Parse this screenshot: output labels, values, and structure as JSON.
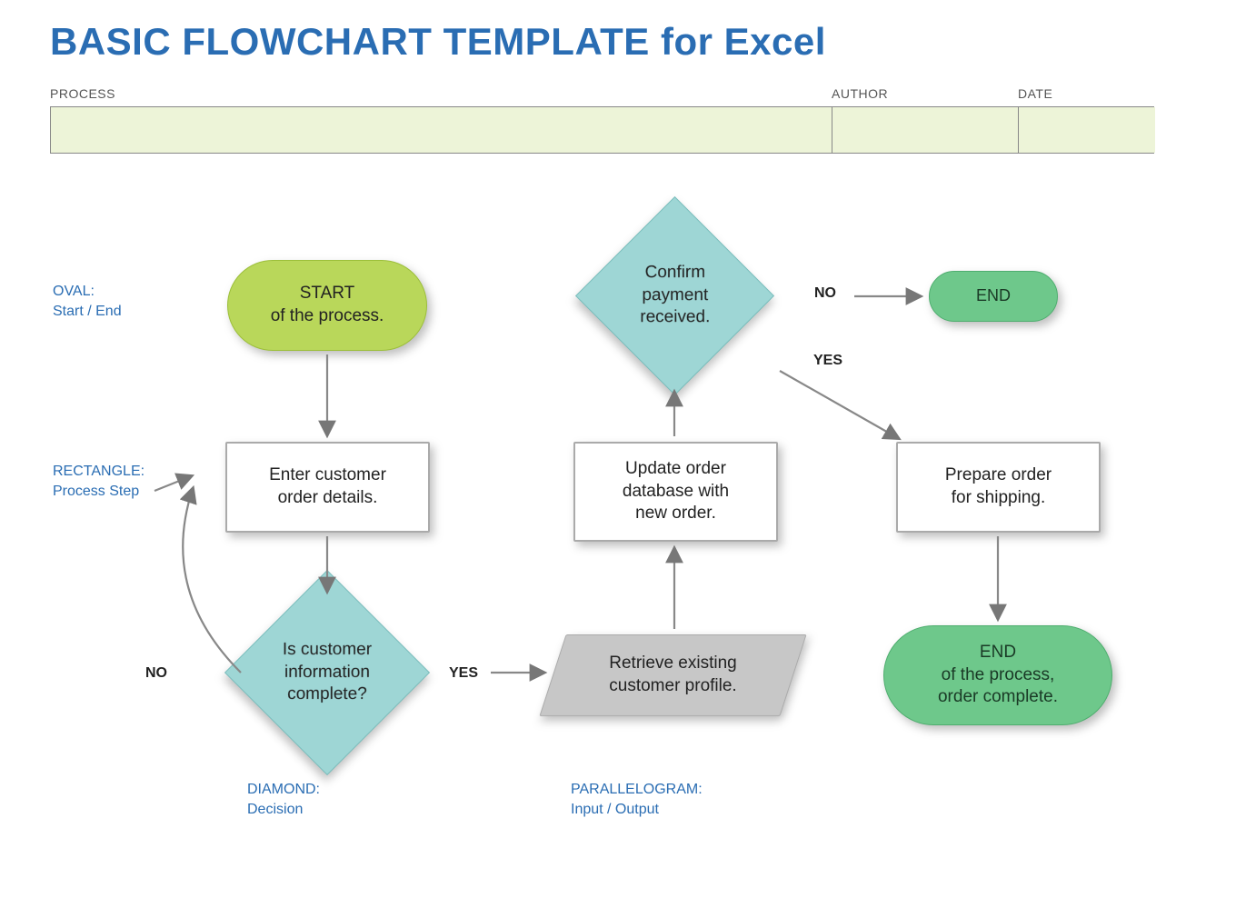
{
  "title": "BASIC FLOWCHART TEMPLATE for Excel",
  "header": {
    "process_label": "PROCESS",
    "author_label": "AUTHOR",
    "date_label": "DATE",
    "process_value": "",
    "author_value": "",
    "date_value": ""
  },
  "legend": {
    "oval_title": "OVAL:",
    "oval_sub": "Start / End",
    "rect_title": "RECTANGLE:",
    "rect_sub": "Process Step",
    "diamond_title": "DIAMOND:",
    "diamond_sub": "Decision",
    "para_title": "PARALLELOGRAM:",
    "para_sub": "Input / Output"
  },
  "nodes": {
    "start": "START\nof the process.",
    "enter_order": "Enter customer\norder details.",
    "info_complete": "Is customer\ninformation\ncomplete?",
    "retrieve_profile": "Retrieve existing\ncustomer profile.",
    "update_db": "Update order\ndatabase with\nnew order.",
    "confirm_payment": "Confirm\npayment\nreceived.",
    "prepare_ship": "Prepare order\nfor shipping.",
    "end_small": "END",
    "end_full": "END\nof the process,\norder complete."
  },
  "edges": {
    "no1": "NO",
    "yes1": "YES",
    "no2": "NO",
    "yes2": "YES"
  },
  "chart_data": {
    "type": "flowchart",
    "shapes_legend": {
      "oval": "Start / End",
      "rectangle": "Process Step",
      "diamond": "Decision",
      "parallelogram": "Input / Output"
    },
    "nodes": [
      {
        "id": "start",
        "shape": "oval",
        "label": "START of the process."
      },
      {
        "id": "enter_order",
        "shape": "rectangle",
        "label": "Enter customer order details."
      },
      {
        "id": "info_complete",
        "shape": "diamond",
        "label": "Is customer information complete?"
      },
      {
        "id": "retrieve_profile",
        "shape": "parallelogram",
        "label": "Retrieve existing customer profile."
      },
      {
        "id": "update_db",
        "shape": "rectangle",
        "label": "Update order database with new order."
      },
      {
        "id": "confirm_payment",
        "shape": "diamond",
        "label": "Confirm payment received."
      },
      {
        "id": "prepare_ship",
        "shape": "rectangle",
        "label": "Prepare order for shipping."
      },
      {
        "id": "end_small",
        "shape": "oval",
        "label": "END"
      },
      {
        "id": "end_full",
        "shape": "oval",
        "label": "END of the process, order complete."
      }
    ],
    "edges": [
      {
        "from": "start",
        "to": "enter_order",
        "label": ""
      },
      {
        "from": "enter_order",
        "to": "info_complete",
        "label": ""
      },
      {
        "from": "info_complete",
        "to": "enter_order",
        "label": "NO"
      },
      {
        "from": "info_complete",
        "to": "retrieve_profile",
        "label": "YES"
      },
      {
        "from": "retrieve_profile",
        "to": "update_db",
        "label": ""
      },
      {
        "from": "update_db",
        "to": "confirm_payment",
        "label": ""
      },
      {
        "from": "confirm_payment",
        "to": "end_small",
        "label": "NO"
      },
      {
        "from": "confirm_payment",
        "to": "prepare_ship",
        "label": "YES"
      },
      {
        "from": "prepare_ship",
        "to": "end_full",
        "label": ""
      }
    ]
  }
}
